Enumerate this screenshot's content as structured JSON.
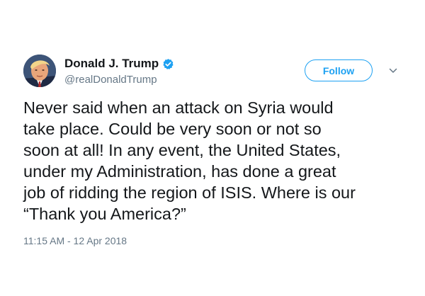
{
  "tweet": {
    "author": {
      "display_name": "Donald J. Trump",
      "handle": "@realDonaldTrump",
      "verified": true,
      "avatar_icon": "profile-photo"
    },
    "follow_label": "Follow",
    "menu_icon": "chevron-down-icon",
    "text": "Never said when an attack on Syria would\ntake place. Could be very soon or not so\nsoon at all! In any event, the United States,\nunder my Administration, has done a great\njob of ridding the region of ISIS. Where is our\n“Thank you America?”",
    "timestamp": "11:15 AM - 12 Apr 2018"
  },
  "colors": {
    "accent": "#1da1f2",
    "text": "#14171a",
    "secondary_text": "#657786",
    "background": "#ffffff"
  }
}
